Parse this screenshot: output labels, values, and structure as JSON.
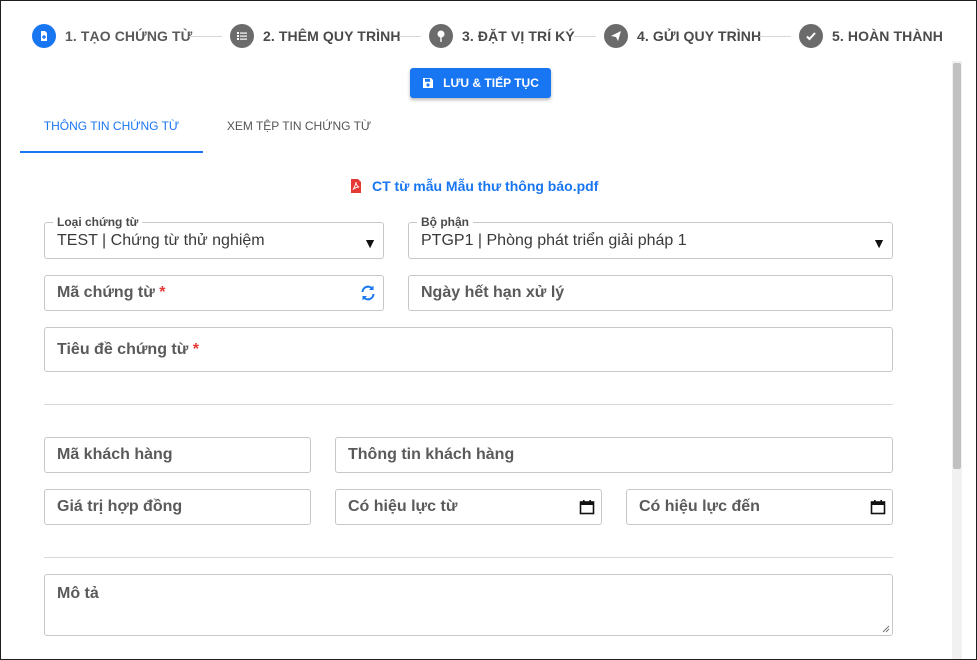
{
  "stepper": {
    "steps": [
      {
        "label": "1. TẠO CHỨNG TỪ",
        "icon": "document-plus-icon",
        "active": true
      },
      {
        "label": "2. THÊM QUY TRÌNH",
        "icon": "list-icon",
        "active": false
      },
      {
        "label": "3. ĐẶT VỊ TRÍ KÝ",
        "icon": "map-pin-icon",
        "active": false
      },
      {
        "label": "4. GỬI QUY TRÌNH",
        "icon": "paper-plane-icon",
        "active": false
      },
      {
        "label": "5. HOÀN THÀNH",
        "icon": "check-circle-icon",
        "active": false
      }
    ]
  },
  "toolbar": {
    "save_label": "LƯU & TIẾP TỤC"
  },
  "tabs": [
    {
      "label": "THÔNG TIN CHỨNG TỪ",
      "active": true
    },
    {
      "label": "XEM TỆP TIN CHỨNG TỪ",
      "active": false
    }
  ],
  "file": {
    "name": "CT từ mẫu Mẫu thư thông báo.pdf",
    "icon": "pdf-file-icon"
  },
  "form": {
    "document_type": {
      "legend": "Loại chứng từ",
      "value": "TEST | Chứng từ thử nghiệm"
    },
    "department": {
      "legend": "Bộ phận",
      "value": "PTGP1 | Phòng phát triển giải pháp 1"
    },
    "document_code": {
      "placeholder": "Mã chứng từ",
      "required_mark": "*"
    },
    "due_date": {
      "placeholder": "Ngày hết hạn xử lý"
    },
    "title": {
      "placeholder": "Tiêu đề chứng từ",
      "required_mark": "*"
    },
    "customer_code": {
      "placeholder": "Mã khách hàng"
    },
    "customer_info": {
      "placeholder": "Thông tin khách hàng"
    },
    "contract_value": {
      "placeholder": "Giá trị hợp đồng"
    },
    "effective_from": {
      "placeholder": "Có hiệu lực từ"
    },
    "effective_to": {
      "placeholder": "Có hiệu lực đến"
    },
    "description": {
      "placeholder": "Mô tả"
    }
  },
  "colors": {
    "accent": "#1976f2",
    "required": "#e53935",
    "pdf": "#e53935",
    "inactive_step": "#6b6b6b"
  }
}
